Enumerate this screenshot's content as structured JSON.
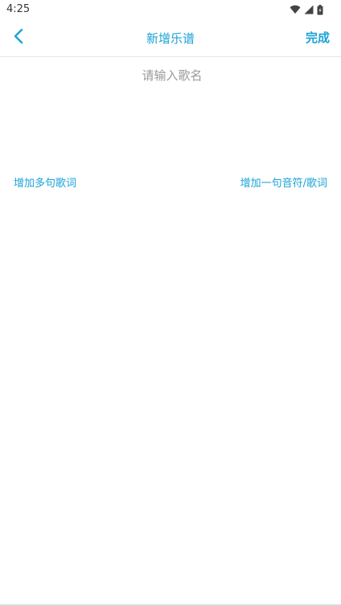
{
  "status_bar": {
    "time": "4:25",
    "icons": [
      "wifi-icon",
      "cell-signal-icon",
      "battery-icon"
    ]
  },
  "header": {
    "back_icon": "chevron-left-icon",
    "title": "新增乐谱",
    "done_label": "完成"
  },
  "song_name": {
    "value": "",
    "placeholder": "请输入歌名"
  },
  "actions": {
    "add_multiple_lyrics": "增加多句歌词",
    "add_note_lyric_line": "增加一句音符/歌词"
  },
  "colors": {
    "accent": "#1aa3d6",
    "placeholder": "#9a9a9a",
    "divider": "#e6e6e6"
  }
}
